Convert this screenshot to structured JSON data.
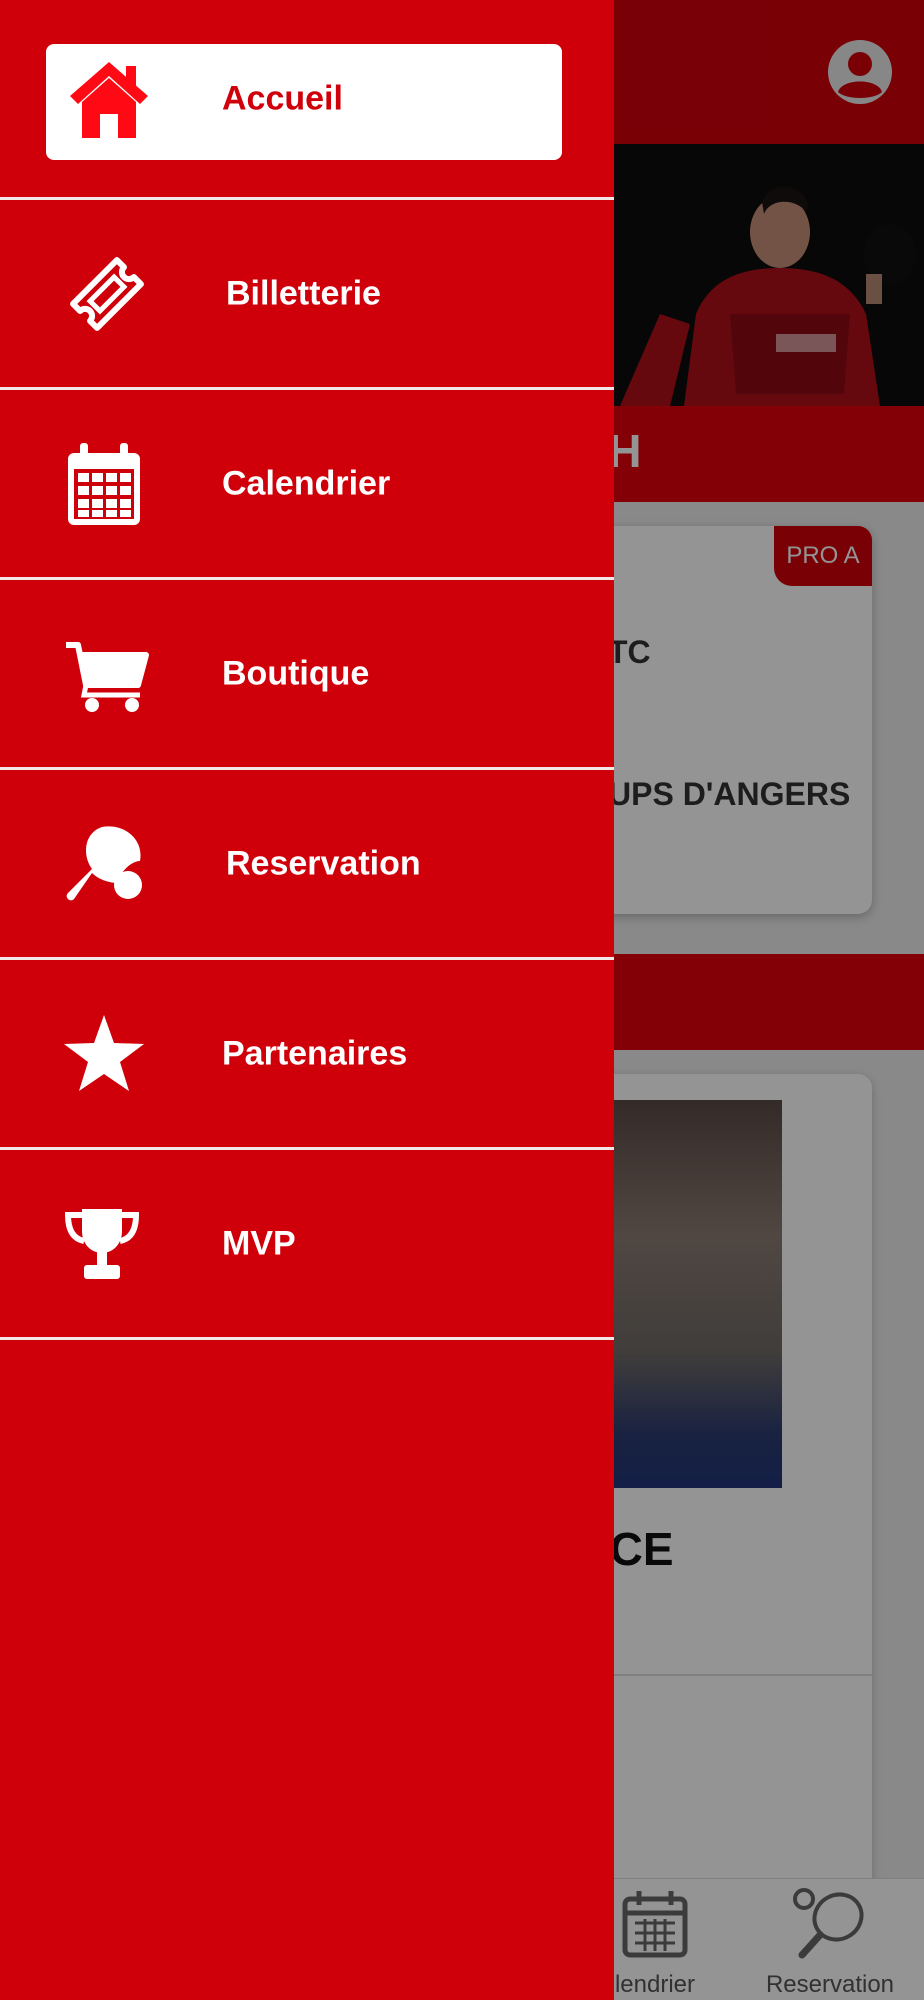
{
  "background": {
    "section_title": "CH",
    "match_badge": "PRO A",
    "match_team_top": "TC",
    "match_team_bottom": "UPS D'ANGERS",
    "news_title": "RANCE",
    "bottom_nav": [
      {
        "label": "lendrier",
        "icon": "calendar-icon"
      },
      {
        "label": "Reservation",
        "icon": "ping-pong-icon"
      }
    ]
  },
  "drawer": {
    "items": [
      {
        "label": "Accueil",
        "icon": "home-icon",
        "active": true
      },
      {
        "label": "Billetterie",
        "icon": "ticket-icon",
        "active": false
      },
      {
        "label": "Calendrier",
        "icon": "calendar-icon",
        "active": false
      },
      {
        "label": "Boutique",
        "icon": "cart-icon",
        "active": false
      },
      {
        "label": "Reservation",
        "icon": "ping-pong-icon",
        "active": false
      },
      {
        "label": "Partenaires",
        "icon": "star-icon",
        "active": false
      },
      {
        "label": "MVP",
        "icon": "trophy-icon",
        "active": false
      }
    ]
  },
  "colors": {
    "brand_red": "#d0000a",
    "separator": "#f2e6e6",
    "active_bg": "#ffffff"
  }
}
